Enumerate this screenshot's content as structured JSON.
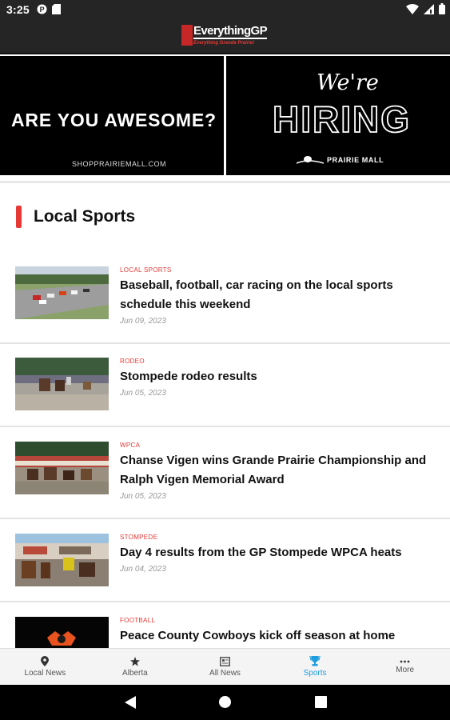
{
  "status": {
    "time": "3:25"
  },
  "app": {
    "logo_main": "EverythingGP",
    "logo_tagline": "Everything Grande Prairie!"
  },
  "banner": {
    "headline": "ARE YOU AWESOME?",
    "url": "SHOPPRAIRIEMALL.COM",
    "were": "We're",
    "hiring": "HIRING",
    "mall": "PRAIRIE MALL"
  },
  "section": {
    "title": "Local Sports"
  },
  "articles": [
    {
      "category": "LOCAL SPORTS",
      "title": "Baseball, football, car racing on the local sports schedule this weekend",
      "date": "Jun 09, 2023"
    },
    {
      "category": "RODEO",
      "title": "Stompede rodeo results",
      "date": "Jun 05, 2023"
    },
    {
      "category": "WPCA",
      "title": "Chanse Vigen wins Grande Prairie Championship and Ralph Vigen Memorial Award",
      "date": "Jun 05, 2023"
    },
    {
      "category": "STOMPEDE",
      "title": "Day 4 results from the GP Stompede WPCA heats",
      "date": "Jun 04, 2023"
    },
    {
      "category": "FOOTBALL",
      "title": "Peace County Cowboys kick off season at home Saturday",
      "date": ""
    }
  ],
  "nav": [
    {
      "label": "Local News",
      "icon": "location-pin-icon"
    },
    {
      "label": "Alberta",
      "icon": "star-icon"
    },
    {
      "label": "All News",
      "icon": "newspaper-icon"
    },
    {
      "label": "Sports",
      "icon": "trophy-icon"
    },
    {
      "label": "More",
      "icon": "more-dots-icon"
    }
  ],
  "colors": {
    "accent_red": "#e53935",
    "active_blue": "#1e9ee0",
    "dark_bar": "#252525"
  }
}
